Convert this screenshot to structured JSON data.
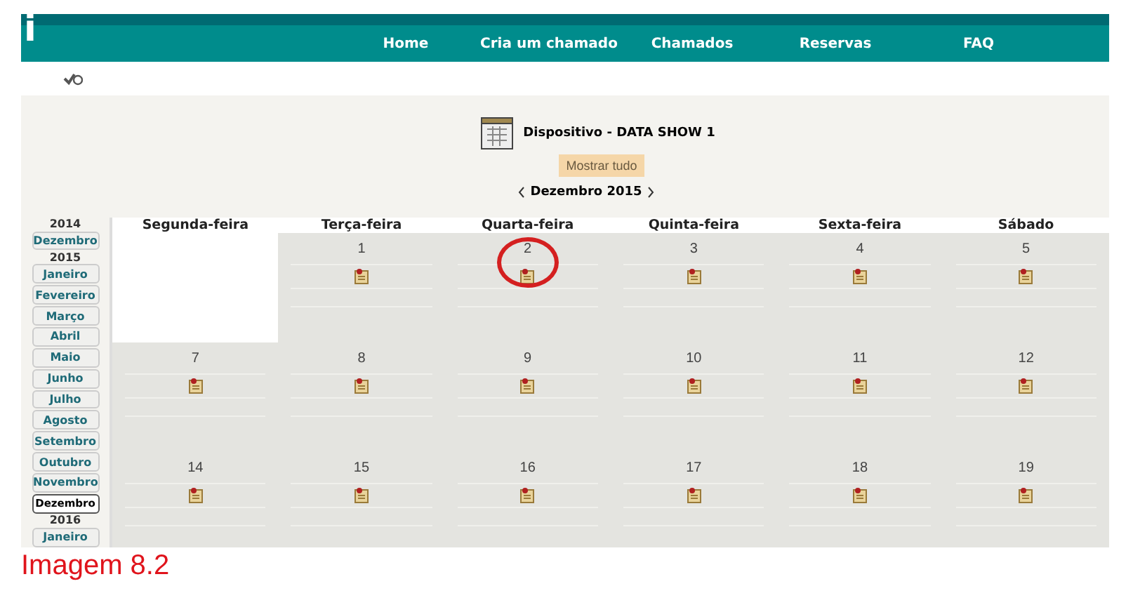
{
  "header": {
    "logo": "i",
    "nav": [
      {
        "label": "Home"
      },
      {
        "label": "Cria um chamado"
      },
      {
        "label": "Chamados"
      },
      {
        "label": "Reservas"
      },
      {
        "label": "FAQ"
      }
    ]
  },
  "device": {
    "title": "Dispositivo - DATA SHOW 1",
    "show_all": "Mostrar tudo",
    "month": "Dezembro 2015"
  },
  "sidebar": [
    {
      "year": "2014",
      "months": [
        {
          "label": "Dezembro",
          "selected": false
        }
      ]
    },
    {
      "year": "2015",
      "months": [
        {
          "label": "Janeiro",
          "selected": false
        },
        {
          "label": "Fevereiro",
          "selected": false
        },
        {
          "label": "Março",
          "selected": false
        },
        {
          "label": "Abril",
          "selected": false
        },
        {
          "label": "Maio",
          "selected": false
        },
        {
          "label": "Junho",
          "selected": false
        },
        {
          "label": "Julho",
          "selected": false
        },
        {
          "label": "Agosto",
          "selected": false
        },
        {
          "label": "Setembro",
          "selected": false
        },
        {
          "label": "Outubro",
          "selected": false
        },
        {
          "label": "Novembro",
          "selected": false
        },
        {
          "label": "Dezembro",
          "selected": true
        }
      ]
    },
    {
      "year": "2016",
      "months": [
        {
          "label": "Janeiro",
          "selected": false
        }
      ]
    }
  ],
  "calendar": {
    "weekdays": [
      "Segunda-feira",
      "Terça-feira",
      "Quarta-feira",
      "Quinta-feira",
      "Sexta-feira",
      "Sábado"
    ],
    "weeks": [
      [
        {
          "kind": "blank"
        },
        {
          "kind": "day",
          "day": "1",
          "highlighted": false
        },
        {
          "kind": "day",
          "day": "2",
          "highlighted": true
        },
        {
          "kind": "day",
          "day": "3",
          "highlighted": false
        },
        {
          "kind": "day",
          "day": "4",
          "highlighted": false
        },
        {
          "kind": "day",
          "day": "5",
          "highlighted": false
        }
      ],
      [
        {
          "kind": "day",
          "day": "7",
          "highlighted": false
        },
        {
          "kind": "day",
          "day": "8",
          "highlighted": false
        },
        {
          "kind": "day",
          "day": "9",
          "highlighted": false
        },
        {
          "kind": "day",
          "day": "10",
          "highlighted": false
        },
        {
          "kind": "day",
          "day": "11",
          "highlighted": false
        },
        {
          "kind": "day",
          "day": "12",
          "highlighted": false
        }
      ],
      [
        {
          "kind": "day",
          "day": "14",
          "highlighted": false
        },
        {
          "kind": "day",
          "day": "15",
          "highlighted": false
        },
        {
          "kind": "day",
          "day": "16",
          "highlighted": false
        },
        {
          "kind": "day",
          "day": "17",
          "highlighted": false
        },
        {
          "kind": "day",
          "day": "18",
          "highlighted": false
        },
        {
          "kind": "day",
          "day": "19",
          "highlighted": false
        }
      ]
    ]
  },
  "caption": "Imagem 8.2"
}
